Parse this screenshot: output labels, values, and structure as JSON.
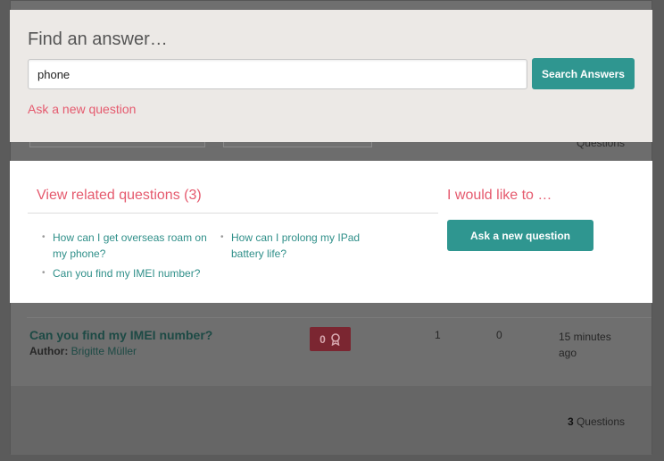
{
  "search": {
    "heading": "Find an answer…",
    "input_value": "phone",
    "button_label": "Search Answers",
    "ask_link": "Ask a new question"
  },
  "related": {
    "heading": "View related questions (3)",
    "questions": [
      "How can I get overseas roam on my phone?",
      "Can you find my IMEI number?",
      "How can I prolong my IPad battery life?"
    ]
  },
  "action": {
    "heading": "I would like to …",
    "button_label": "Ask a new question"
  },
  "background": {
    "count_top_suffix": "Questions",
    "row": {
      "title": "Can you find my IMEI number?",
      "author_label": "Author:",
      "author_name": "Brigitte Müller",
      "badge_count": "0",
      "col_a": "1",
      "col_b": "0",
      "time": "15 minutes ago"
    },
    "count_bottom_number": "3",
    "count_bottom_suffix": "Questions"
  },
  "colors": {
    "accent_teal": "#2f9690",
    "accent_pink": "#e55a6e"
  }
}
